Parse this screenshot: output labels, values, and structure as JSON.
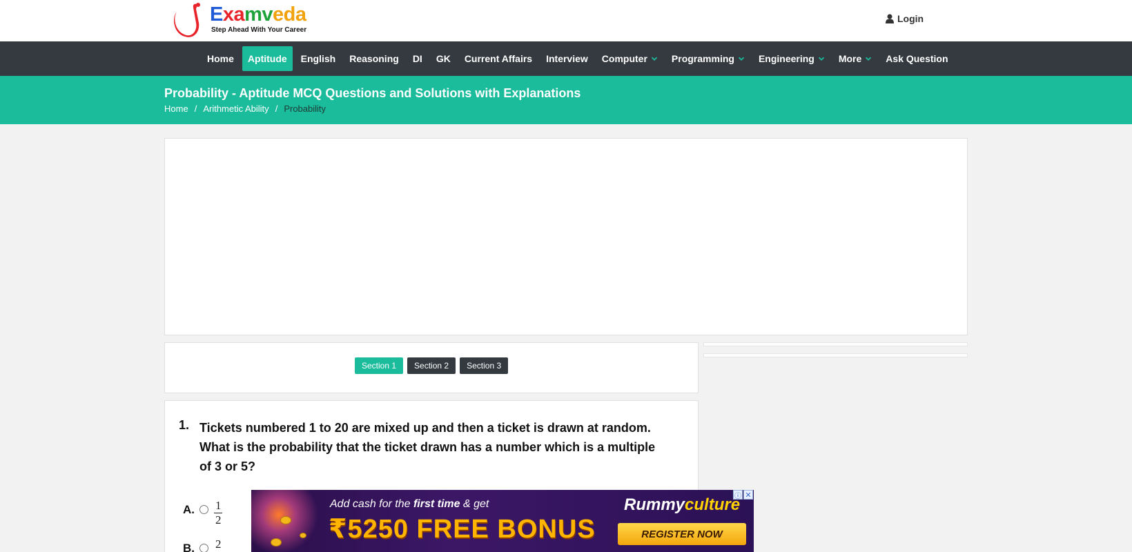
{
  "header": {
    "logo_text": {
      "p1": "E",
      "p2": "xa",
      "p3": "mv",
      "p4": "eda"
    },
    "tagline": "Step Ahead With Your Career",
    "login_label": "Login",
    "login_icon": "user-icon"
  },
  "nav": {
    "items": [
      {
        "label": "Home",
        "dropdown": false,
        "active": false
      },
      {
        "label": "Aptitude",
        "dropdown": false,
        "active": true
      },
      {
        "label": "English",
        "dropdown": false,
        "active": false
      },
      {
        "label": "Reasoning",
        "dropdown": false,
        "active": false
      },
      {
        "label": "DI",
        "dropdown": false,
        "active": false
      },
      {
        "label": "GK",
        "dropdown": false,
        "active": false
      },
      {
        "label": "Current Affairs",
        "dropdown": false,
        "active": false
      },
      {
        "label": "Interview",
        "dropdown": false,
        "active": false
      },
      {
        "label": "Computer",
        "dropdown": true,
        "active": false
      },
      {
        "label": "Programming",
        "dropdown": true,
        "active": false
      },
      {
        "label": "Engineering",
        "dropdown": true,
        "active": false
      },
      {
        "label": "More",
        "dropdown": true,
        "active": false
      },
      {
        "label": "Ask Question",
        "dropdown": false,
        "active": false
      }
    ]
  },
  "title_band": {
    "title": "Probability - Aptitude MCQ Questions and Solutions with Explanations",
    "breadcrumb": [
      "Home",
      "Arithmetic Ability",
      "Probability"
    ],
    "separator": "/"
  },
  "sections": {
    "buttons": [
      {
        "label": "Section 1",
        "active": true
      },
      {
        "label": "Section 2",
        "active": false
      },
      {
        "label": "Section 3",
        "active": false
      }
    ]
  },
  "question": {
    "number": "1.",
    "text": "Tickets numbered 1 to 20 are mixed up and then a ticket is drawn at random. What is the probability that the ticket drawn has a number which is a multiple of 3 or 5?",
    "options": [
      {
        "letter": "A.",
        "numerator": "1",
        "denominator": "2"
      },
      {
        "letter": "B.",
        "numerator": "2",
        "denominator": ""
      }
    ]
  },
  "ad": {
    "line1_a": "Add cash for the ",
    "line1_b": "first time",
    "line1_c": " & get",
    "line2": "₹5250 FREE BONUS",
    "brand_a": "Rummy",
    "brand_b": "culture",
    "cta": "REGISTER NOW",
    "info_glyph": "ⓘ",
    "close_glyph": "✕"
  },
  "colors": {
    "accent": "#1abc9c",
    "navbar": "#343a40",
    "page_bg": "#f2f2f2"
  }
}
